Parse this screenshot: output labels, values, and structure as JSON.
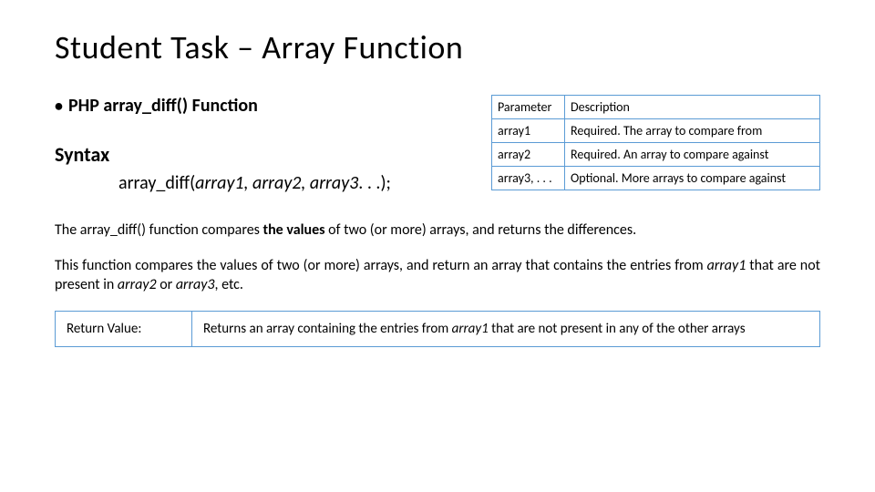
{
  "title": "Student Task – Array Function",
  "subhead": "PHP array_diff() Function",
  "syntax": {
    "label": "Syntax",
    "fn": "array_diff(",
    "args": "array1, array2, array3",
    "tail": ". . .);"
  },
  "param_table": {
    "headers": {
      "col1": "Parameter",
      "col2": "Description"
    },
    "rows": [
      {
        "param": "array1",
        "desc": "Required. The array to compare from"
      },
      {
        "param": "array2",
        "desc": "Required. An array to compare against"
      },
      {
        "param": "array3, . . .",
        "desc": "Optional. More arrays to compare against"
      }
    ]
  },
  "para1_a": "The array_diff() function compares ",
  "para1_b": "the values",
  "para1_c": " of two (or more) arrays, and returns the differences.",
  "para2_a": "This function compares the values of two (or more) arrays, and return an array that contains the entries from ",
  "para2_b": "array1",
  "para2_c": " that are not present in ",
  "para2_d": "array2",
  "para2_e": " or ",
  "para2_f": "array3",
  "para2_g": ", etc.",
  "return_table": {
    "label": "Return Value:",
    "text_a": "Returns an array containing the entries from ",
    "text_b": "array1",
    "text_c": " that are not present in any of the other arrays"
  }
}
